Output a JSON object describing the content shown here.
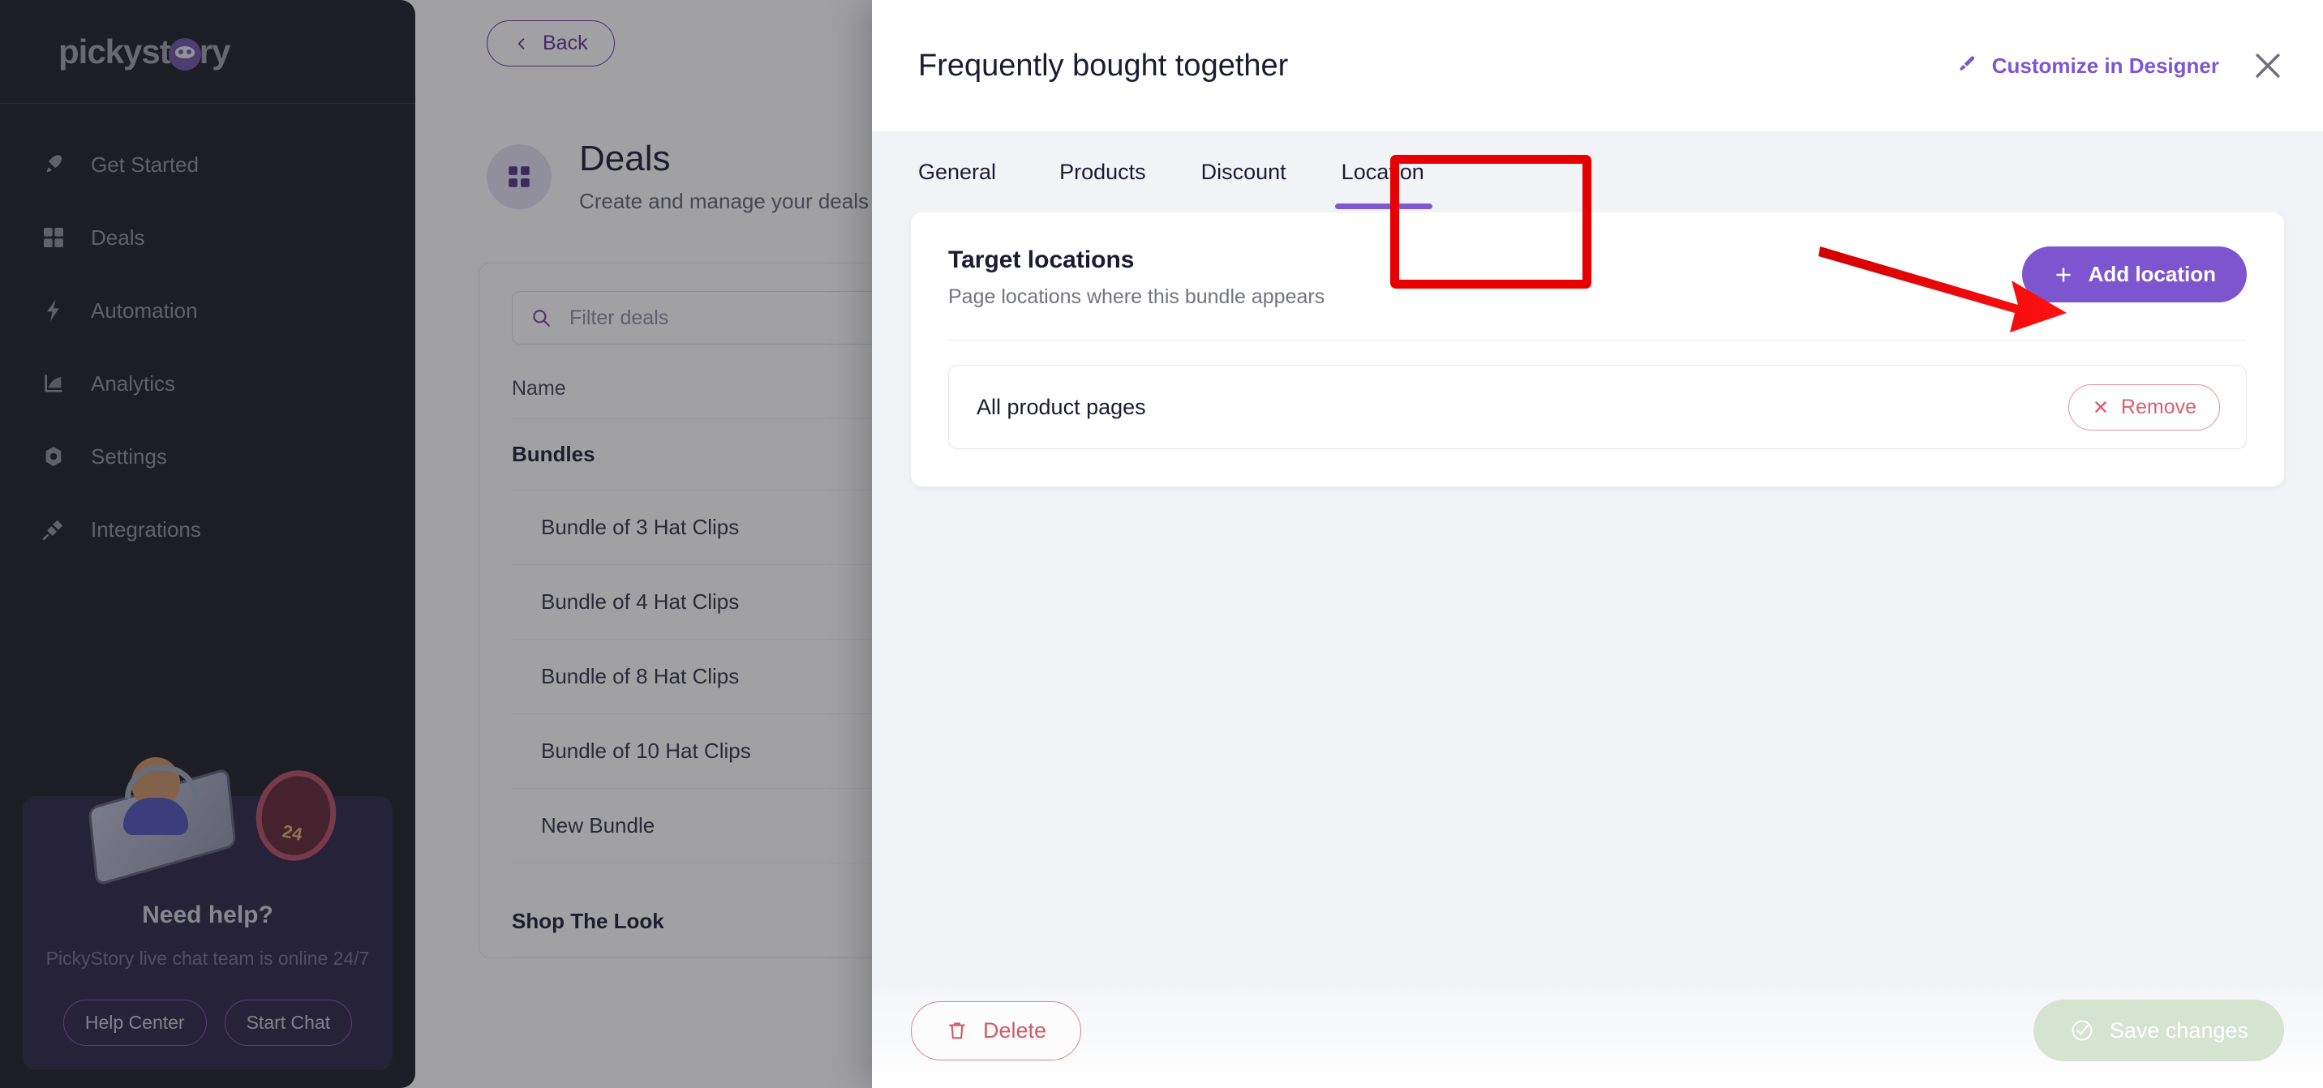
{
  "sidebar": {
    "logo_pre": "pickyst",
    "logo_post": "ry",
    "items": [
      {
        "label": "Get Started",
        "icon": "rocket-icon"
      },
      {
        "label": "Deals",
        "icon": "grid-icon"
      },
      {
        "label": "Automation",
        "icon": "bolt-icon"
      },
      {
        "label": "Analytics",
        "icon": "chart-icon"
      },
      {
        "label": "Settings",
        "icon": "gear-icon"
      },
      {
        "label": "Integrations",
        "icon": "plug-icon"
      }
    ],
    "help": {
      "title": "Need help?",
      "subtitle": "PickyStory live chat team is online 24/7",
      "help_center": "Help Center",
      "start_chat": "Start Chat"
    }
  },
  "page": {
    "back": "Back",
    "title": "Deals",
    "subtitle": "Create and manage your deals",
    "filter_placeholder": "Filter deals",
    "table": {
      "column_name": "Name",
      "groups": [
        {
          "name": "Bundles",
          "rows": [
            "Bundle of 3 Hat Clips",
            "Bundle of 4 Hat Clips",
            "Bundle of 8 Hat Clips",
            "Bundle of 10 Hat Clips",
            "New Bundle"
          ]
        },
        {
          "name": "Shop The Look",
          "rows": []
        }
      ]
    }
  },
  "modal": {
    "title": "Frequently bought together",
    "customize_label": "Customize in Designer",
    "close_icon": "close-icon",
    "tabs": [
      {
        "label": "General",
        "active": false
      },
      {
        "label": "Products",
        "active": false
      },
      {
        "label": "Discount",
        "active": false
      },
      {
        "label": "Location",
        "active": true
      }
    ],
    "panel": {
      "title": "Target locations",
      "subtitle": "Page locations where this bundle appears",
      "add_button": "Add location",
      "locations": [
        {
          "name": "All product pages",
          "remove_label": "Remove"
        }
      ]
    },
    "footer": {
      "delete_label": "Delete",
      "save_label": "Save changes"
    }
  },
  "colors": {
    "accent_purple": "#7d55cf",
    "brand_purple": "#5b2d91",
    "annotation_red": "#e60000",
    "danger_red": "#d9606e",
    "save_disabled_green": "#d5e3d1",
    "sidebar_bg": "#14151f",
    "modal_bg": "#f2f3f7"
  }
}
